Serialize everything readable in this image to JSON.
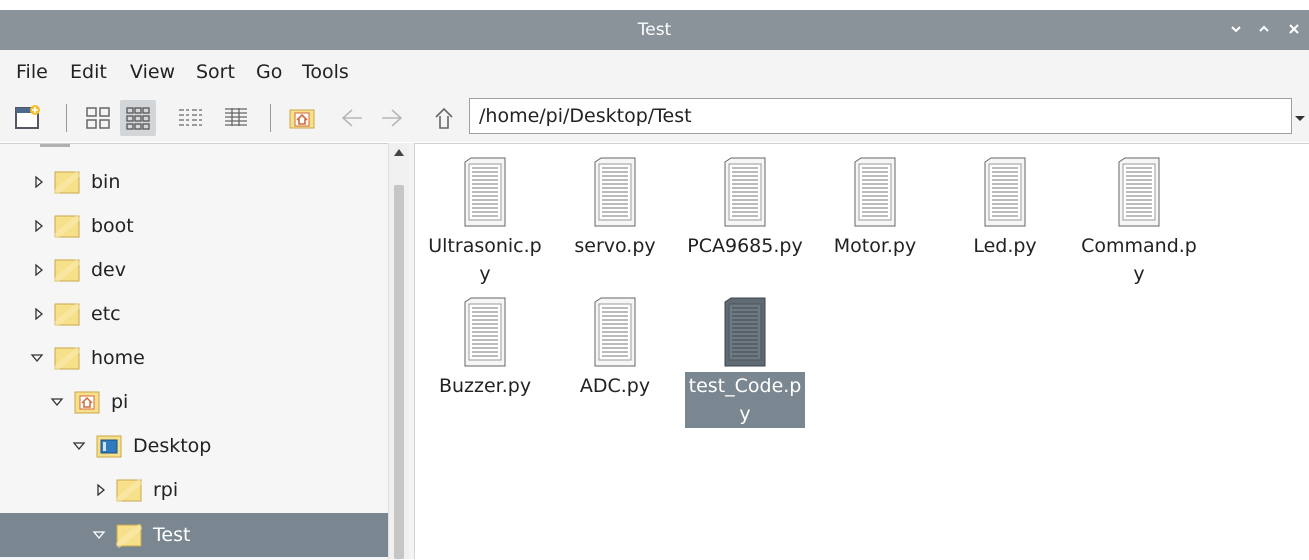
{
  "window": {
    "title": "Test",
    "controls": {
      "minimize": "⌄",
      "maximize": "⌃",
      "close": "×"
    }
  },
  "menubar": {
    "file": "File",
    "edit": "Edit",
    "view": "View",
    "sort": "Sort",
    "go": "Go",
    "tools": "Tools"
  },
  "toolbar": {
    "path": "/home/pi/Desktop/Test"
  },
  "sidebar": {
    "items": [
      {
        "label": "bin",
        "expander": "collapsed",
        "icon": "folder-icon"
      },
      {
        "label": "boot",
        "expander": "collapsed",
        "icon": "folder-icon"
      },
      {
        "label": "dev",
        "expander": "collapsed",
        "icon": "folder-icon"
      },
      {
        "label": "etc",
        "expander": "collapsed",
        "icon": "folder-icon"
      },
      {
        "label": "home",
        "expander": "expanded",
        "icon": "folder-icon"
      },
      {
        "label": "pi",
        "expander": "expanded",
        "icon": "home-folder-icon"
      },
      {
        "label": "Desktop",
        "expander": "expanded",
        "icon": "desktop-folder-icon"
      },
      {
        "label": "rpi",
        "expander": "collapsed",
        "icon": "folder-icon"
      },
      {
        "label": "Test",
        "expander": "expanded",
        "icon": "folder-icon",
        "selected": true
      }
    ]
  },
  "files": [
    {
      "name": "Ultrasonic.py"
    },
    {
      "name": "servo.py"
    },
    {
      "name": "PCA9685.py"
    },
    {
      "name": "Motor.py"
    },
    {
      "name": "Led.py"
    },
    {
      "name": "Command.py"
    },
    {
      "name": "Buzzer.py"
    },
    {
      "name": "ADC.py"
    },
    {
      "name": "test_Code.py",
      "selected": true
    }
  ],
  "colors": {
    "titlebar": "#8a939a",
    "selection": "#7b8790",
    "folder": "#f7e08a"
  }
}
